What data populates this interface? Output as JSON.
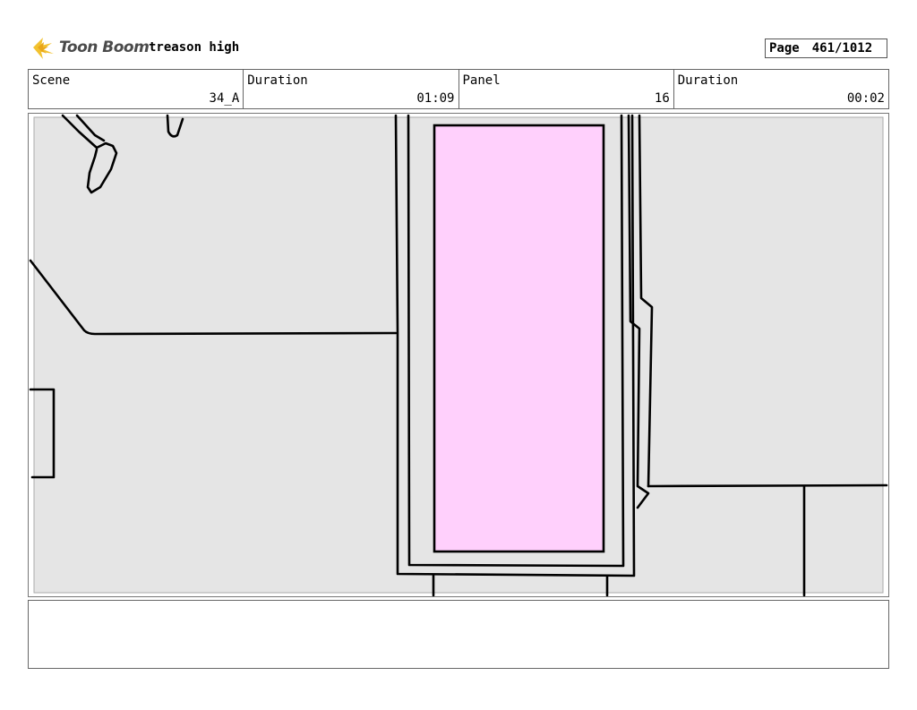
{
  "header": {
    "logo_text": "Toon Boom",
    "project_title": "treason high",
    "page_label": "Page",
    "page_value": "461/1012"
  },
  "info": [
    {
      "label": "Scene",
      "value": "34_A"
    },
    {
      "label": "Duration",
      "value": "01:09"
    },
    {
      "label": "Panel",
      "value": "16"
    },
    {
      "label": "Duration",
      "value": "00:02"
    }
  ],
  "panel": {
    "background_color": "#e5e5e5",
    "door_fill_color": "#ffd0fc",
    "line_color": "#000000"
  },
  "notes": {
    "text": ""
  }
}
